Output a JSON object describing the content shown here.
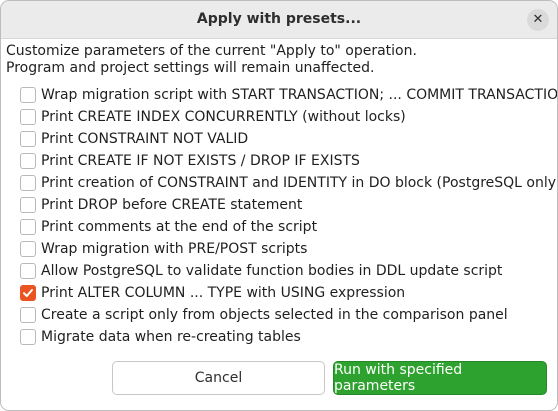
{
  "dialog": {
    "title": "Apply with presets...",
    "close_icon": "close-icon"
  },
  "description": {
    "line1": "Customize parameters of the current \"Apply to\" operation.",
    "line2": "Program and project settings will remain unaffected."
  },
  "options": [
    {
      "label": "Wrap migration script with START TRANSACTION; ... COMMIT TRANSACTION;",
      "checked": false
    },
    {
      "label": "Print CREATE INDEX CONCURRENTLY (without locks)",
      "checked": false
    },
    {
      "label": "Print CONSTRAINT NOT VALID",
      "checked": false
    },
    {
      "label": "Print CREATE IF NOT EXISTS / DROP IF EXISTS",
      "checked": false
    },
    {
      "label": "Print creation of CONSTRAINT and IDENTITY in DO block (PostgreSQL only)",
      "checked": false
    },
    {
      "label": "Print DROP before CREATE statement",
      "checked": false
    },
    {
      "label": "Print comments at the end of the script",
      "checked": false
    },
    {
      "label": "Wrap migration with PRE/POST scripts",
      "checked": false
    },
    {
      "label": "Allow PostgreSQL to validate function bodies in DDL update script",
      "checked": false
    },
    {
      "label": "Print ALTER COLUMN ... TYPE with USING expression",
      "checked": true
    },
    {
      "label": "Create a script only from objects selected in the comparison panel",
      "checked": false
    },
    {
      "label": "Migrate data when re-creating tables",
      "checked": false
    }
  ],
  "buttons": {
    "cancel": "Cancel",
    "run": "Run with specified parameters"
  },
  "colors": {
    "checkbox_checked": "#e95420",
    "primary_button": "#2ea22e"
  }
}
